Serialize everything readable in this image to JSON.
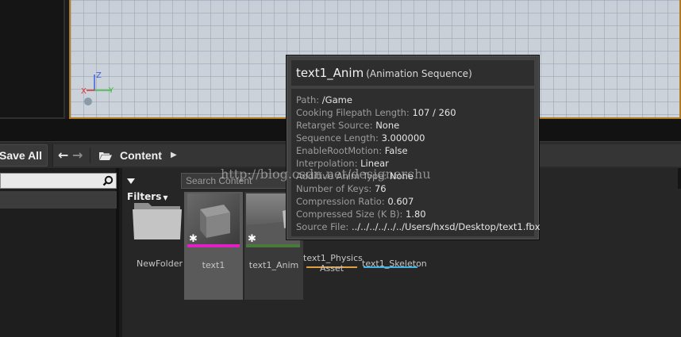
{
  "toolbar": {
    "save_all": "Save All",
    "breadcrumb": "Content"
  },
  "content": {
    "filters": "Filters",
    "search_placeholder": "Search Content",
    "assets": [
      {
        "label": "NewFolder"
      },
      {
        "label": "text1",
        "bar_color": "#e020c0"
      },
      {
        "label": "text1_Anim",
        "bar_color": "#4a7a3a"
      },
      {
        "label": "text1_Physics\nAsset",
        "bar_color": "#e0a040"
      },
      {
        "label": "text1_Skeleton",
        "bar_color": "#40b0e0"
      }
    ]
  },
  "tooltip": {
    "title": "text1_Anim",
    "type": "(Animation Sequence)",
    "rows": [
      {
        "key": "Path:",
        "value": "/Game"
      },
      {
        "key": "Cooking Filepath Length:",
        "value": "107 / 260"
      },
      {
        "key": "Retarget Source:",
        "value": "None"
      },
      {
        "key": "Sequence Length:",
        "value": "3.000000"
      },
      {
        "key": "EnableRootMotion:",
        "value": "False"
      },
      {
        "key": "Interpolation:",
        "value": "Linear"
      },
      {
        "key": "Additive Anim Type:",
        "value": "None"
      },
      {
        "key": "Number of Keys:",
        "value": "76"
      },
      {
        "key": "Compression Ratio:",
        "value": "0.607"
      },
      {
        "key": "Compressed Size (K B):",
        "value": "1.80"
      },
      {
        "key": "Source File:",
        "value": "../../../../../../Users/hxsd/Desktop/text1.fbx"
      }
    ]
  },
  "viewport": {
    "axis_x": "X",
    "axis_y": "Y",
    "axis_z": "Z"
  },
  "watermark": "http://blog.csdn.net/designerchu",
  "colors": {
    "viewport_border": "#b07a20",
    "axis_x": "#e03030",
    "axis_y": "#40c040",
    "axis_z": "#4060e0"
  }
}
